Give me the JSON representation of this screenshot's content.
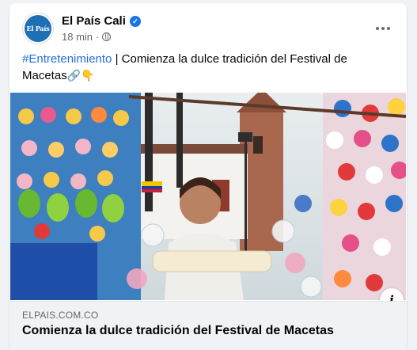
{
  "post": {
    "author": "El País Cali",
    "avatar_text": "El País",
    "time": "18 min",
    "separator": "·",
    "hashtag": "#Entretenimiento",
    "text": " | Comienza la dulce tradición del Festival de Macetas",
    "emojis": "🔗👇",
    "verified_icon": "check-badge",
    "audience_icon": "globe-icon"
  },
  "link": {
    "domain": "ELPAIS.COM.CO",
    "title": "Comienza la dulce tradición del Festival de Macetas",
    "info_label": "i"
  },
  "colors": {
    "accent": "#216fdb",
    "verified": "#1b74e4",
    "link_bg": "#f0f2f5"
  }
}
